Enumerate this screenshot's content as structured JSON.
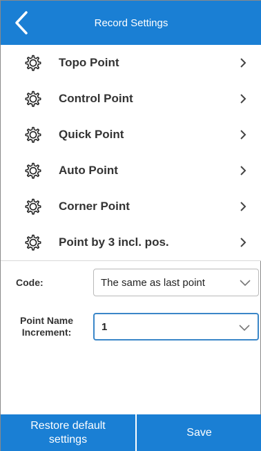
{
  "header": {
    "title": "Record Settings",
    "back_icon": "chevron-left-icon",
    "color": "#1a7fd4"
  },
  "menu": {
    "items": [
      {
        "label": "Topo Point",
        "icon": "gear-icon"
      },
      {
        "label": "Control Point",
        "icon": "gear-icon"
      },
      {
        "label": "Quick Point",
        "icon": "gear-icon"
      },
      {
        "label": "Auto Point",
        "icon": "gear-icon"
      },
      {
        "label": "Corner Point",
        "icon": "gear-icon"
      },
      {
        "label": "Point by 3 incl. pos.",
        "icon": "gear-icon"
      }
    ]
  },
  "fields": {
    "code": {
      "label": "Code:",
      "value": "The same as last point"
    },
    "point_name_increment": {
      "label_line1": "Point Name",
      "label_line2": "Increment:",
      "value": "1"
    }
  },
  "footer": {
    "restore_line1": "Restore default",
    "restore_line2": "settings",
    "save_label": "Save"
  }
}
